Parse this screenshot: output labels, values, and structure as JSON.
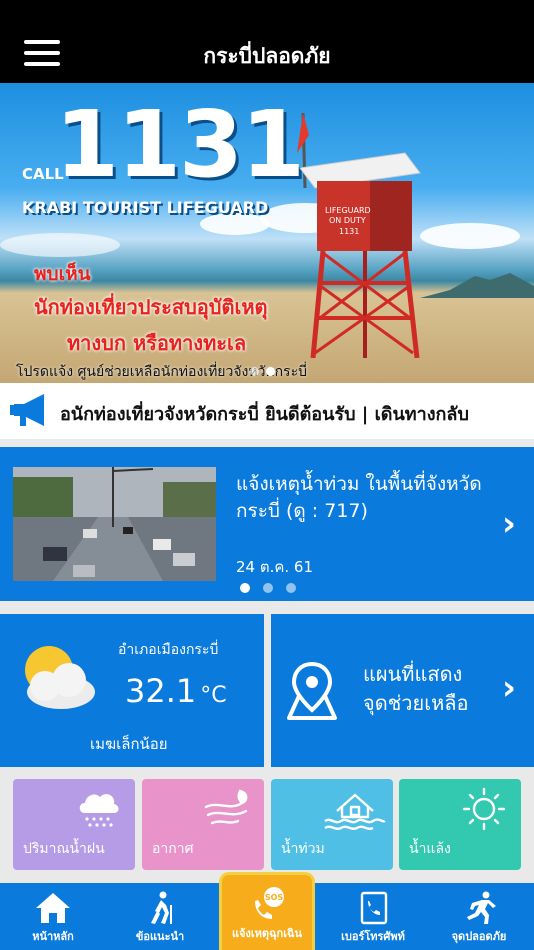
{
  "header": {
    "title": "กระบี่ปลอดภัย",
    "menu_icon": "hamburger-icon"
  },
  "banner": {
    "call": "CALL",
    "number": "1131",
    "subtitle": "KRABI TOURIST LIFEGUARD",
    "slogan1": "พบเห็น",
    "slogan2": "นักท่องเที่ยวประสบอุบัติเหตุ",
    "slogan3": "ทางบก หรือทางทะเล",
    "footer": "โปรดแจ้ง ศูนย์ช่วยเหลือนักท่องเที่ยวจังหวัดกระบี่",
    "tower_sign": "LIFEGUARD ON DUTY",
    "tower_number": "1131",
    "slide_count": 2,
    "active_slide": 1
  },
  "ticker": {
    "icon": "megaphone-icon",
    "text": "อนักท่องเที่ยวจังหวัดกระบี่ ยินดีต้อนรับ | เดินทางกลับ"
  },
  "news": {
    "title": "แจ้งเหตุน้ำท่วม ในพื้นที่จังหวัดกระบี่ (ดู : 717)",
    "date": "24 ต.ค. 61",
    "slide_count": 3,
    "active_slide": 0,
    "image": "flooded-street-photo"
  },
  "weather": {
    "district": "อำเภอเมืองกระบี่",
    "temperature": "32.1",
    "unit": "°C",
    "condition": "เมฆเล็กน้อย",
    "icon": "partly-cloudy-icon"
  },
  "map": {
    "title_line1": "แผนที่แสดง",
    "title_line2": "จุดช่วยเหลือ",
    "icon": "map-pin-icon"
  },
  "tiles": [
    {
      "label": "ปริมาณน้ำฝน",
      "icon": "rain-cloud-icon",
      "color": "#b69be6"
    },
    {
      "label": "อากาศ",
      "icon": "wind-icon",
      "color": "#e893c9"
    },
    {
      "label": "น้ำท่วม",
      "icon": "flood-house-icon",
      "color": "#4fbfe6"
    },
    {
      "label": "น้ำแล้ง",
      "icon": "sun-icon",
      "color": "#33c8b0"
    }
  ],
  "nav": {
    "home": "หน้าหลัก",
    "advice": "ข้อแนะนำ",
    "sos": "แจ้งเหตุฉุกเฉิน",
    "sos_badge": "SOS",
    "phone": "เบอร์โทรศัพท์",
    "safe_points": "จุดปลอดภัย"
  },
  "colors": {
    "primary": "#0a7bdc",
    "header": "#000000",
    "sos": "#f7ad1b"
  }
}
